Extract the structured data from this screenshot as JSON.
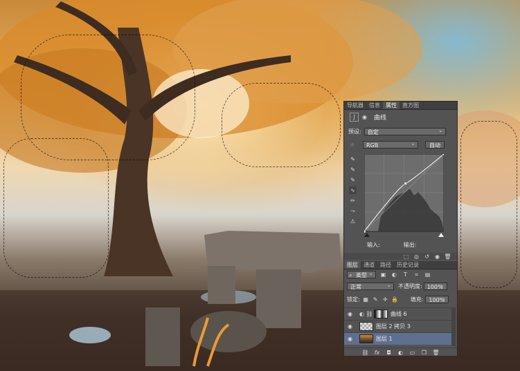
{
  "colors": {
    "panel_bg": "#535353",
    "selected_layer": "#5f6f8e",
    "canvas_warm": "#e0a040",
    "sky_blue": "#78bee6"
  },
  "panel": {
    "top_tabs": [
      "导航器",
      "信息",
      "属性",
      "直方图"
    ],
    "active_top_tab": "属性",
    "adjustment_title": "曲线",
    "preset_label": "预设:",
    "preset_value": "自定",
    "channel_value": "RGB",
    "auto_button": "自动",
    "input_label": "输入:",
    "output_label": "输出:",
    "curve_points": [
      [
        0,
        0
      ],
      [
        0.52,
        0.62
      ],
      [
        1,
        1
      ]
    ]
  },
  "layers_panel": {
    "tabs": [
      "图层",
      "通道",
      "路径",
      "历史记录"
    ],
    "active_tab": "图层",
    "filter_label": "类型",
    "blend_mode": "正常",
    "opacity_label": "不透明度:",
    "opacity_value": "100%",
    "lock_label": "锁定:",
    "fill_label": "填充:",
    "fill_value": "100%",
    "layers": [
      {
        "name": "曲线 6",
        "type": "adjustment",
        "selected": false
      },
      {
        "name": "图层 2 拷贝 3",
        "type": "transparent",
        "selected": false
      },
      {
        "name": "图层 1",
        "type": "photo",
        "selected": true
      }
    ],
    "footer_icons": [
      "link-icon",
      "fx-icon",
      "mask-icon",
      "adjustment-icon",
      "folder-icon",
      "new-layer-icon",
      "trash-icon"
    ]
  }
}
